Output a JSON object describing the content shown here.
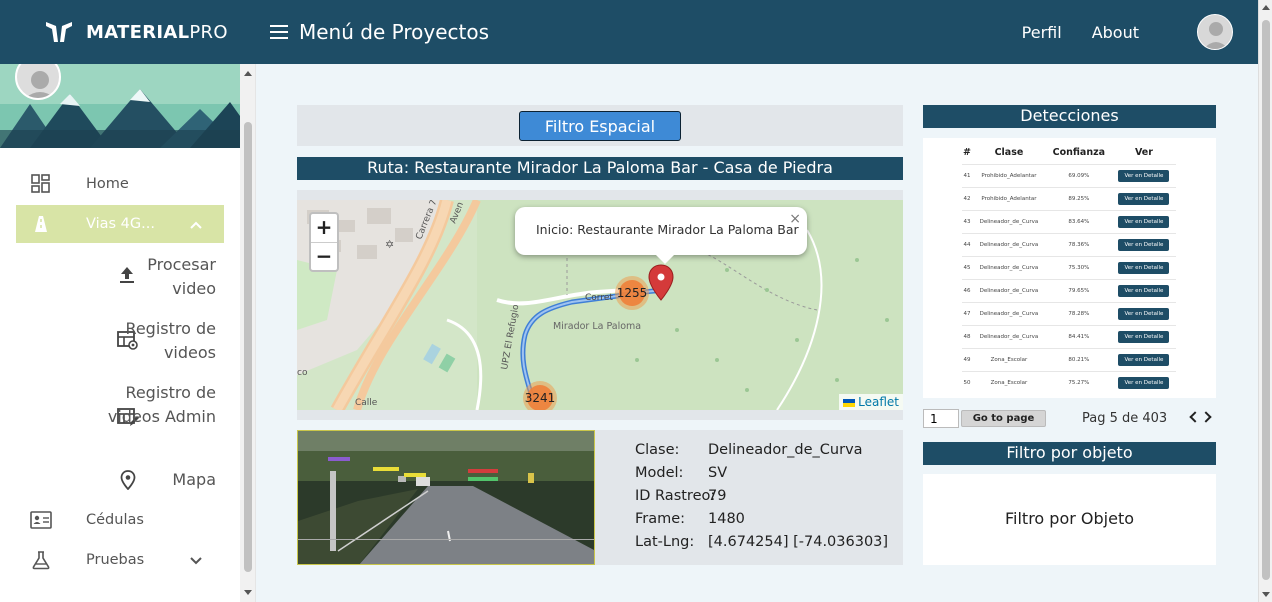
{
  "app": {
    "brand_bold": "MATERIAL",
    "brand_light": "PRO",
    "title": "Menú de Proyectos"
  },
  "topnav": {
    "perfil": "Perfil",
    "about": "About"
  },
  "sidebar": {
    "items": [
      {
        "label": "Home"
      },
      {
        "label": "Vias 4G..."
      },
      {
        "label": "Cédulas"
      },
      {
        "label": "Pruebas"
      }
    ],
    "subitems": [
      {
        "label": "Procesar video"
      },
      {
        "label": "Registro de videos"
      },
      {
        "label": "Registro de videos Admin"
      },
      {
        "label": "Mapa"
      }
    ]
  },
  "main": {
    "filter_button": "Filtro Espacial",
    "route": "Ruta: Restaurante Mirador La Paloma Bar - Casa de Piedra",
    "map": {
      "popup_text": "Inicio: Restaurante Mirador La Paloma Bar",
      "popup_close": "×",
      "zoom_in": "+",
      "zoom_out": "−",
      "clusters": [
        "1255",
        "3241"
      ],
      "labels": {
        "carrera7": "Carrera 7",
        "mirador": "Mirador La Paloma",
        "upz": "UPZ El Refugio",
        "avenida": "Aven",
        "corret": "Corret",
        "calle": "Calle",
        "co": "co"
      },
      "attribution": "Leaflet"
    },
    "detail": {
      "clase_k": "Clase:",
      "clase_v": "Delineador_de_Curva",
      "model_k": "Model:",
      "model_v": "SV",
      "id_k": "ID Rastreo:",
      "id_v": "79",
      "frame_k": "Frame:",
      "frame_v": "1480",
      "latlng_k": "Lat-Lng:",
      "latlng_v": "[4.674254] [-74.036303]"
    }
  },
  "detecciones": {
    "title": "Detecciones",
    "headers": [
      "#",
      "Clase",
      "Confianza",
      "Ver"
    ],
    "button_label": "Ver en Detalle",
    "rows": [
      {
        "n": "41",
        "clase": "Prohibido_Adelantar",
        "conf": "69.09%"
      },
      {
        "n": "42",
        "clase": "Prohibido_Adelantar",
        "conf": "89.25%"
      },
      {
        "n": "43",
        "clase": "Delineador_de_Curva",
        "conf": "83.64%"
      },
      {
        "n": "44",
        "clase": "Delineador_de_Curva",
        "conf": "78.36%"
      },
      {
        "n": "45",
        "clase": "Delineador_de_Curva",
        "conf": "75.30%"
      },
      {
        "n": "46",
        "clase": "Delineador_de_Curva",
        "conf": "79.65%"
      },
      {
        "n": "47",
        "clase": "Delineador_de_Curva",
        "conf": "78.28%"
      },
      {
        "n": "48",
        "clase": "Delineador_de_Curva",
        "conf": "84.41%"
      },
      {
        "n": "49",
        "clase": "Zona_Escolar",
        "conf": "80.21%"
      },
      {
        "n": "50",
        "clase": "Zona_Escolar",
        "conf": "75.27%"
      }
    ],
    "page_input": "1",
    "go_label": "Go to page",
    "page_text": "Pag 5 de 403"
  },
  "filtro_objeto": {
    "title": "Filtro por objeto",
    "body": "Filtro por Objeto"
  },
  "colors": {
    "primary": "#1e4d66",
    "active_nav": "#d8e4a6",
    "button": "#3e8ad6",
    "marker": "#d43a3a",
    "route": "#3f7fd6",
    "cluster": "#ee803a"
  }
}
